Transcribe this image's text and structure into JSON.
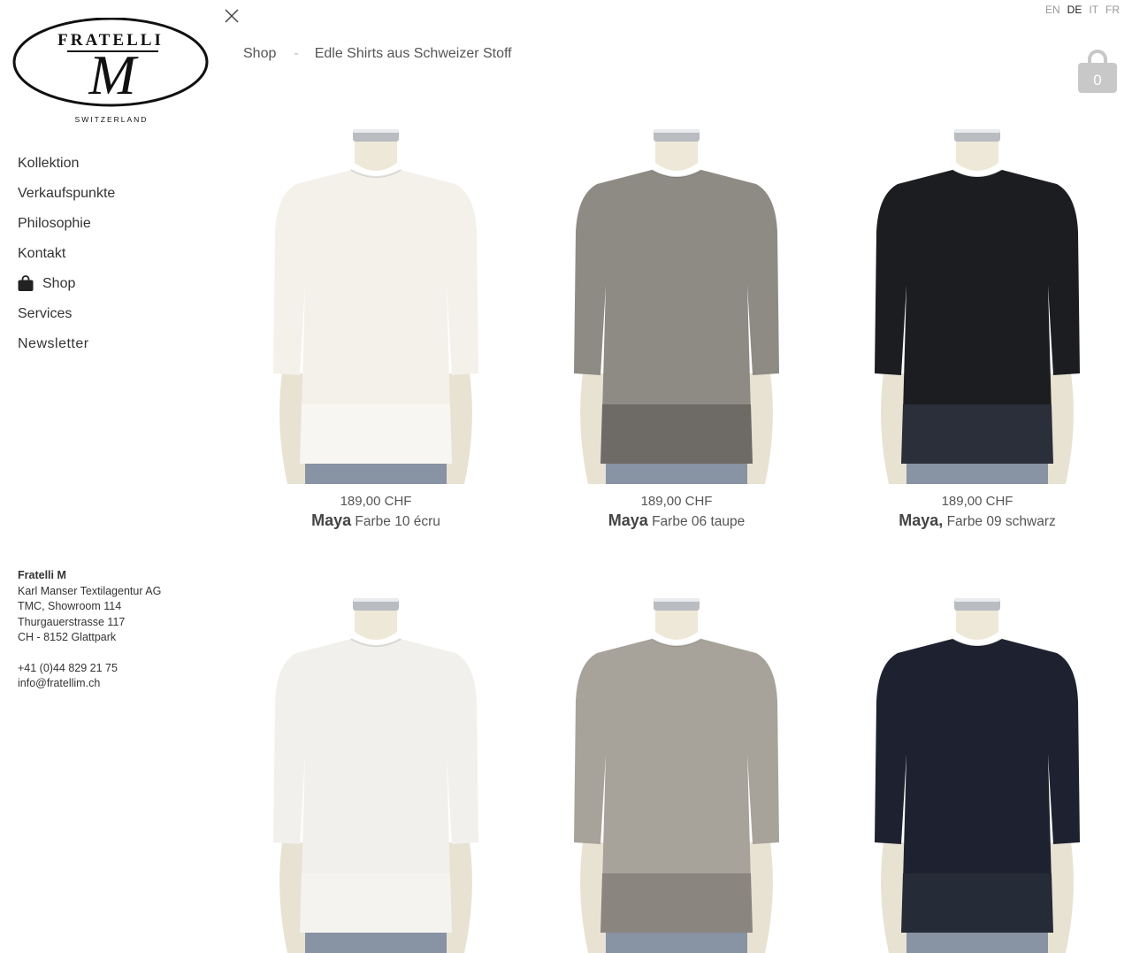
{
  "brand": {
    "name": "FRATELLI",
    "monogram": "M",
    "country": "SWITZERLAND"
  },
  "close_icon": "close-icon",
  "languages": [
    {
      "label": "EN",
      "active": false
    },
    {
      "label": "DE",
      "active": true
    },
    {
      "label": "IT",
      "active": false
    },
    {
      "label": "FR",
      "active": false
    }
  ],
  "breadcrumb": {
    "root": "Shop",
    "separator": "-",
    "current": "Edle Shirts aus Schweizer Stoff"
  },
  "cart": {
    "icon": "shopping-bag-icon",
    "count": "0"
  },
  "nav": {
    "items": [
      {
        "label": "Kollektion"
      },
      {
        "label": "Verkaufspunkte"
      },
      {
        "label": "Philosophie"
      },
      {
        "label": "Kontakt"
      },
      {
        "label": "Shop",
        "icon": "shopping-bag-icon"
      },
      {
        "label": "Services"
      },
      {
        "label": "Newsletter"
      }
    ]
  },
  "address": {
    "company": "Fratelli M",
    "line1": "Karl Manser Textilagentur AG",
    "line2": "TMC, Showroom 114",
    "line3": "Thurgauerstrasse 117",
    "line4": "CH - 8152 Glattpark",
    "phone": "+41 (0)44 829 21 75",
    "email": "info@fratellim.ch"
  },
  "products": [
    {
      "price": "189,00 CHF",
      "name": "Maya",
      "variant": "Farbe 10 écru",
      "shirt_color": "#f3f1ea",
      "hem_color": "#f7f6f2"
    },
    {
      "price": "189,00 CHF",
      "name": "Maya",
      "variant": "Farbe 06 taupe",
      "shirt_color": "#8e8a84",
      "hem_color": "#6e6a65"
    },
    {
      "price": "189,00 CHF",
      "name": "Maya,",
      "variant": "Farbe 09 schwarz",
      "shirt_color": "#1c1d20",
      "hem_color": "#2a2f3a"
    },
    {
      "shirt_color": "#f1f0ec",
      "hem_color": "#f4f3ef"
    },
    {
      "shirt_color": "#a7a29a",
      "hem_color": "#8a857f"
    },
    {
      "shirt_color": "#1e2230",
      "hem_color": "#262b38"
    }
  ]
}
